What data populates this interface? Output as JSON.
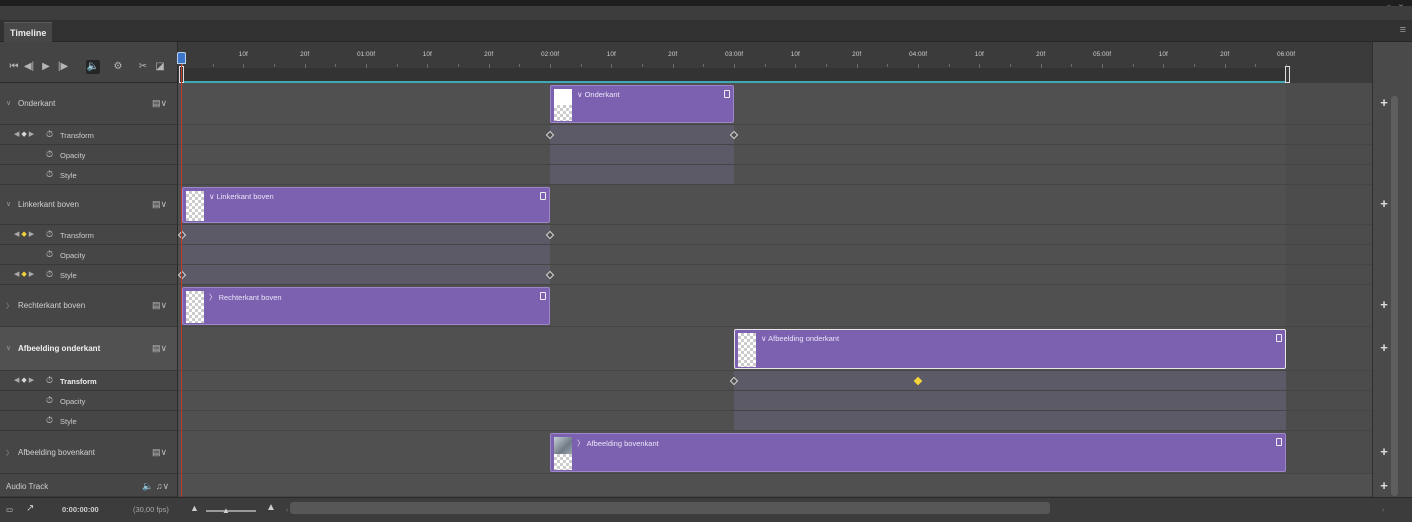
{
  "window": {
    "controls": "« x"
  },
  "panel": {
    "tab": "Timeline",
    "menu_icon": "≡"
  },
  "toolbar": {
    "buttons": [
      {
        "name": "go-to-first-frame-icon",
        "glyph": "⏮"
      },
      {
        "name": "previous-frame-icon",
        "glyph": "◀|"
      },
      {
        "name": "play-icon",
        "glyph": "▶"
      },
      {
        "name": "next-frame-icon",
        "glyph": "|▶"
      },
      {
        "name": "mute-audio-icon",
        "glyph": "🔈"
      },
      {
        "name": "settings-gear-icon",
        "glyph": "⚙"
      },
      {
        "name": "split-scissors-icon",
        "glyph": "✂"
      },
      {
        "name": "transition-icon",
        "glyph": "◪"
      }
    ]
  },
  "ruler": {
    "labels": [
      "10f",
      "20f",
      "01:00f",
      "10f",
      "20f",
      "02:00f",
      "10f",
      "20f",
      "03:00f",
      "10f",
      "20f",
      "04:00f",
      "10f",
      "20f",
      "05:00f",
      "10f",
      "20f",
      "06:00f"
    ]
  },
  "tracks": [
    {
      "name": "Onderkant",
      "expanded": true,
      "chevron": "∨",
      "clip": {
        "name": "Onderkant",
        "chevron": "∨",
        "start": 2.0,
        "end": 3.0,
        "thumb": "white"
      },
      "properties": [
        {
          "name": "Transform",
          "nav": true,
          "keyframes": [
            2.0,
            3.0
          ]
        },
        {
          "name": "Opacity",
          "nav": false,
          "keyframes": []
        },
        {
          "name": "Style",
          "nav": false,
          "keyframes": []
        }
      ]
    },
    {
      "name": "Linkerkant boven",
      "expanded": true,
      "chevron": "∨",
      "clip": {
        "name": "Linkerkant boven",
        "chevron": "∨",
        "start": 0.0,
        "end": 2.0,
        "thumb": "checker"
      },
      "properties": [
        {
          "name": "Transform",
          "nav": true,
          "yellow": true,
          "keyframes": [
            0.0,
            2.0
          ]
        },
        {
          "name": "Opacity",
          "nav": false,
          "keyframes": []
        },
        {
          "name": "Style",
          "nav": true,
          "yellow": true,
          "keyframes": [
            0.0,
            2.0
          ]
        }
      ]
    },
    {
      "name": "Rechterkant boven",
      "expanded": false,
      "chevron": "〉",
      "clip": {
        "name": "Rechterkant boven",
        "chevron": "〉",
        "start": 0.0,
        "end": 2.0,
        "thumb": "checker"
      },
      "properties": []
    },
    {
      "name": "Afbeelding onderkant",
      "expanded": true,
      "selected": true,
      "chevron": "∨",
      "clip": {
        "name": "Afbeelding onderkant",
        "chevron": "∨",
        "start": 3.0,
        "end": 6.0,
        "thumb": "checker",
        "selected": true
      },
      "properties": [
        {
          "name": "Transform",
          "nav": true,
          "bold": true,
          "keyframes": [
            3.0
          ],
          "yellow_keyframes": [
            4.0
          ]
        },
        {
          "name": "Opacity",
          "nav": false,
          "keyframes": []
        },
        {
          "name": "Style",
          "nav": false,
          "keyframes": []
        }
      ]
    },
    {
      "name": "Afbeelding bovenkant",
      "expanded": false,
      "chevron": "〉",
      "clip": {
        "name": "Afbeelding bovenkant",
        "chevron": "〉",
        "start": 2.0,
        "end": 6.0,
        "thumb": "photo"
      },
      "properties": []
    }
  ],
  "audio": {
    "name": "Audio Track",
    "icons": "🔈 ♫∨",
    "plus": "+"
  },
  "bottom": {
    "render_icon": "▭",
    "convert_icon": "↗",
    "timecode": "0:00:00:00",
    "fps": "(30,00 fps)"
  },
  "plus": "+"
}
